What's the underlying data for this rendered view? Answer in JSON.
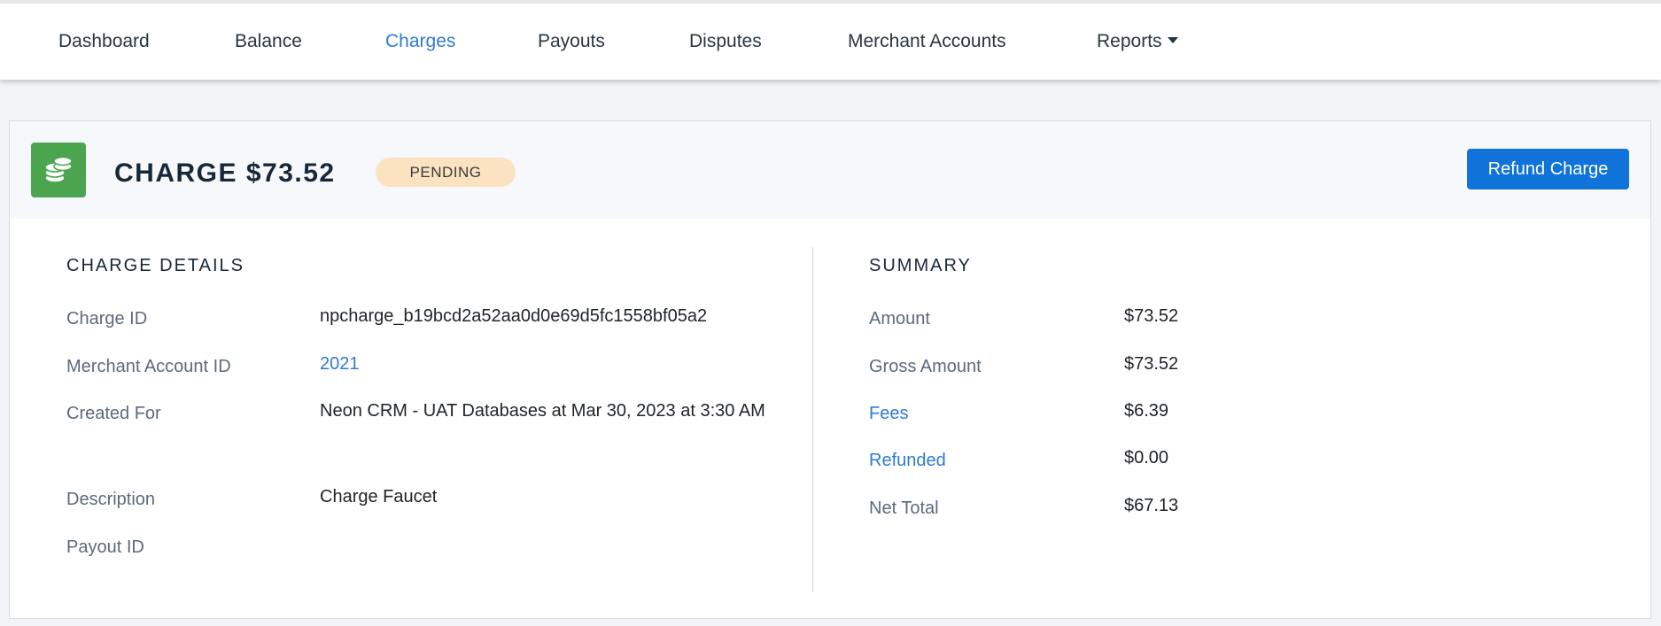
{
  "nav": {
    "items": [
      {
        "label": "Dashboard",
        "active": false
      },
      {
        "label": "Balance",
        "active": false
      },
      {
        "label": "Charges",
        "active": true
      },
      {
        "label": "Payouts",
        "active": false
      },
      {
        "label": "Disputes",
        "active": false
      },
      {
        "label": "Merchant Accounts",
        "active": false
      },
      {
        "label": "Reports",
        "active": false,
        "dropdown": true
      }
    ]
  },
  "header": {
    "icon": "coins-stack-icon",
    "title": "CHARGE $73.52",
    "status": "PENDING",
    "refund_label": "Refund Charge"
  },
  "details": {
    "title": "CHARGE DETAILS",
    "rows": [
      {
        "label": "Charge ID",
        "value": "npcharge_b19bcd2a52aa0d0e69d5fc1558bf05a2"
      },
      {
        "label": "Merchant Account ID",
        "value": "2021"
      },
      {
        "label": "Created For",
        "value": "Neon CRM - UAT Databases at Mar 30, 2023 at 3:30 AM"
      },
      {
        "label": "Description",
        "value": "Charge Faucet"
      },
      {
        "label": "Payout ID",
        "value": ""
      }
    ]
  },
  "summary": {
    "title": "SUMMARY",
    "rows": [
      {
        "label": "Amount",
        "value": "$73.52"
      },
      {
        "label": "Gross Amount",
        "value": "$73.52"
      },
      {
        "label": "Fees",
        "value": "$6.39"
      },
      {
        "label": "Refunded",
        "value": "$0.00"
      },
      {
        "label": "Net Total",
        "value": "$67.13"
      }
    ]
  },
  "colors": {
    "accent": "#2f7bd3",
    "button": "#0f73d9",
    "icon_bg": "#4aa54e",
    "badge_bg": "#fbe3c2"
  }
}
